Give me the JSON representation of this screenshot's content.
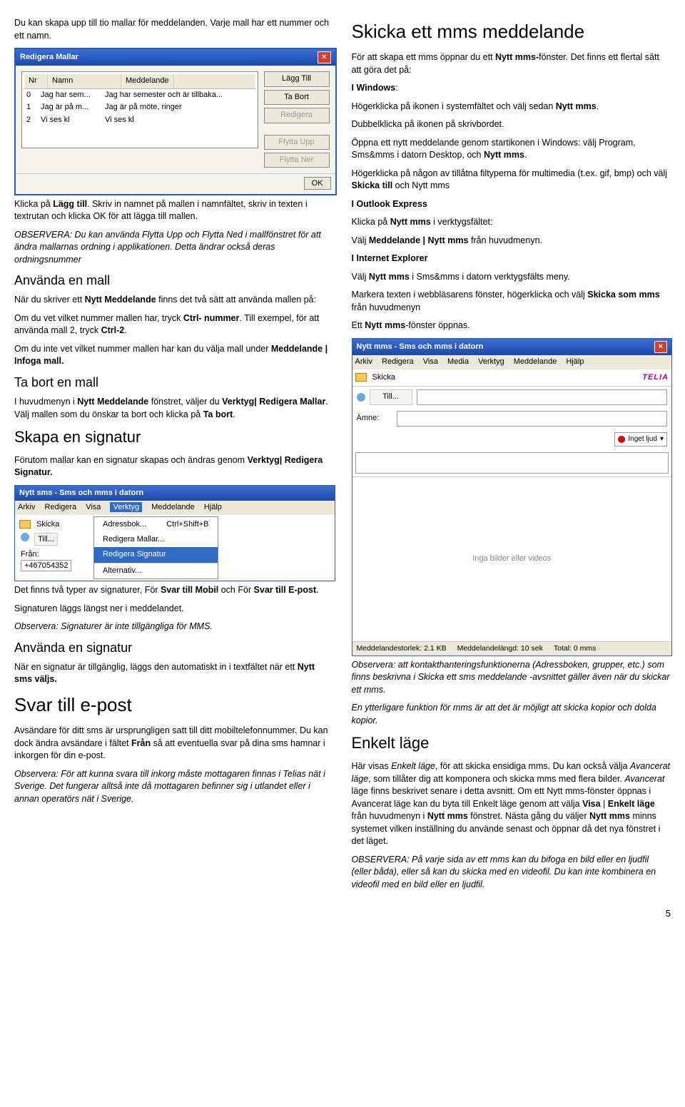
{
  "left": {
    "p1": "Du kan skapa upp till tio mallar för meddelanden. Varje mall har ett nummer och ett namn.",
    "dialog": {
      "title": "Redigera Mallar",
      "cols": [
        "Nr",
        "Namn",
        "Meddelande"
      ],
      "rows": [
        [
          "0",
          "Jag har sem...",
          "Jag har semester och är tillbaka..."
        ],
        [
          "1",
          "Jag är på m...",
          "Jag är på möte, ringer"
        ],
        [
          "2",
          "Vi ses kl",
          "Vi ses kl"
        ]
      ],
      "btns": {
        "lagg": "Lägg Till",
        "tabort": "Ta Bort",
        "redigera": "Redigera",
        "flyttaupp": "Flytta Upp",
        "flyttaner": "Flytta Ner",
        "ok": "OK"
      }
    },
    "p2a": "Klicka på ",
    "p2b": "Lägg till",
    "p2c": ". Skriv in namnet på mallen i namnfältet, skriv in texten i textrutan och klicka OK för att lägga till mallen.",
    "p3": "OBSERVERA: Du kan använda Flytta Upp och Flytta Ned i mallfönstret för att ändra mallarnas ordning i applikationen. Detta ändrar också deras ordningsnummer",
    "h_anvanda_mall": "Använda en mall",
    "p4a": "När du skriver ett ",
    "p4b": "Nytt Meddelande",
    "p4c": " finns det två sätt att använda mallen på:",
    "p5a": "Om du vet vilket nummer mallen har, tryck ",
    "p5b": "Ctrl- nummer",
    "p5c": ". Till exempel, för att använda mall 2, tryck ",
    "p5d": "Ctrl-2",
    "p6a": "Om du inte vet vilket nummer mallen har kan du välja mall under ",
    "p6b": "Meddelande | Infoga mall.",
    "h_tabort": "Ta bort en mall",
    "p7a": "I huvudmenyn i ",
    "p7b": "Nytt Meddelande",
    "p7c": " fönstret, väljer du ",
    "p7d": "Verktyg| Redigera Mallar",
    "p7e": ". Välj mallen som du önskar ta bort och klicka på ",
    "p7f": "Ta bort",
    "h_skapa_sig": "Skapa en signatur",
    "p8a": "Förutom mallar kan en signatur skapas och ändras genom ",
    "p8b": "Verktyg| Redigera Signatur.",
    "win1": {
      "title": "Nytt sms - Sms och mms i datorn",
      "menu": [
        "Arkiv",
        "Redigera",
        "Visa",
        "Verktyg",
        "Meddelande",
        "Hjälp"
      ],
      "skicka": "Skicka",
      "menuitems": [
        {
          "l": "Adressbok...",
          "r": "Ctrl+Shift+B"
        },
        {
          "l": "Redigera Mallar...",
          "r": ""
        },
        {
          "l": "Redigera Signatur",
          "r": ""
        },
        {
          "l": "Alternativ...",
          "r": ""
        }
      ],
      "till": "Till...",
      "fran_lbl": "Från:",
      "fran_val": "+467054352"
    },
    "p9a": "Det finns två typer av signaturer, För ",
    "p9b": "Svar till Mobil",
    "p9c": " och För ",
    "p9d": "Svar till E-post",
    "p10": "Signaturen läggs längst ner i meddelandet.",
    "p11": "Observera: Signaturer är inte tillgängliga för MMS.",
    "h_anvanda_sig": "Använda en signatur",
    "p12a": "När en signatur är tillgänglig, läggs den automatiskt in i textfältet när ett ",
    "p12b": "Nytt sms väljs.",
    "h_svar": "Svar till e-post",
    "p13a": "Avsändare för ditt sms är ursprungligen satt till ditt mobiltelefonnummer. Du kan dock ändra avsändare i fältet ",
    "p13b": "Från",
    "p13c": " så att eventuella svar på dina sms hamnar i inkorgen för din e-post.",
    "p14": "Observera: För att kunna svara till inkorg måste mottagaren finnas i Telias nät i Sverige. Det fungerar alltså inte då mottagaren befinner sig i utlandet eller i annan operatörs nät i Sverige."
  },
  "right": {
    "h_skicka": "Skicka ett mms meddelande",
    "p1a": "För att skapa ett mms öppnar du ett ",
    "p1b": "Nytt mms-",
    "p1c": "fönster. Det finns ett flertal sätt att göra det på:",
    "p2a": "I Windows",
    "p3a": "Högerklicka på ikonen i systemfältet och välj sedan ",
    "p3b": "Nytt mms",
    "p4": "Dubbelklicka på ikonen på skrivbordet.",
    "p5a": "Öppna ett nytt meddelande genom startikonen i Windows: välj Program, Sms&mms i datorn Desktop, och ",
    "p5b": "Nytt mms",
    "p6a": "Högerklicka på någon av tillåtna filtyperna för multimedia (t.ex. gif, bmp) och välj ",
    "p6b": "Skicka till",
    "p6c": " och Nytt mms",
    "p7a": "I Outlook Express",
    "p8a": "Klicka på ",
    "p8b": "Nytt mms",
    "p8c": " i verktygsfältet:",
    "p9a": "Välj ",
    "p9b": "Meddelande | Nytt mms",
    "p9c": " från huvudmenyn.",
    "p10a": "I Internet Explorer",
    "p11a": "Välj ",
    "p11b": "Nytt mms",
    "p11c": " i Sms&mms i datorn verktygsfälts meny.",
    "p12a": "Markera texten i webbläsarens fönster, högerklicka och välj ",
    "p12b": "Skicka som mms",
    "p12c": " från huvudmenyn",
    "p13a": "Ett ",
    "p13b": "Nytt mms",
    "p13c": "-fönster öppnas.",
    "win2": {
      "title": "Nytt mms - Sms och mms i datorn",
      "menu": [
        "Arkiv",
        "Redigera",
        "Visa",
        "Media",
        "Verktyg",
        "Meddelande",
        "Hjälp"
      ],
      "skicka": "Skicka",
      "telia": "TELIA",
      "till": "Till...",
      "amne": "Ämne:",
      "sound": "Inget ljud",
      "content": "Inga bilder eller videos",
      "status": {
        "a_lbl": "Meddelandestorlek:",
        "a_val": "2.1 KB",
        "b_lbl": "Meddelandelängd:",
        "b_val": "10 sek",
        "c_lbl": "Total:",
        "c_val": "0 mms"
      }
    },
    "p14": "Observera: att kontakthanteringsfunktionerna (Adressboken, grupper, etc.) som finns beskrivna i Skicka ett sms meddelande -avsnittet gäller även när du skickar ett mms.",
    "p15": "En ytterligare funktion för mms är att det är möjligt att skicka kopior och dolda kopior.",
    "h_enkelt": "Enkelt läge",
    "p16a": "Här visas ",
    "p16b": "Enkelt läge",
    "p16c": ", för att skicka ensidiga mms. Du kan också välja ",
    "p16d": "Avancerat läge",
    "p16e": ", som tillåter dig att komponera och skicka mms med flera bilder. ",
    "p16f": "Avancerat",
    "p16g": " läge finns beskrivet senare i detta avsnitt. Om ett Nytt mms-fönster öppnas i Avancerat läge kan du byta till Enkelt läge genom att välja ",
    "p16h": "Visa",
    "p16i": " | ",
    "p16j": "Enkelt läge",
    "p16k": " från huvudmenyn i ",
    "p16l": "Nytt mms",
    "p16m": " fönstret. Nästa gång du väljer ",
    "p16n": "Nytt mms",
    "p16o": " minns systemet vilken inställning du använde senast och öppnar då det nya fönstret i det läget.",
    "p17": "OBSERVERA: På varje sida av ett mms kan du bifoga en bild eller en ljudfil (eller båda), eller så kan du skicka med en videofil. Du kan inte kombinera en videofil med en bild eller en ljudfil."
  },
  "pagenum": "5"
}
